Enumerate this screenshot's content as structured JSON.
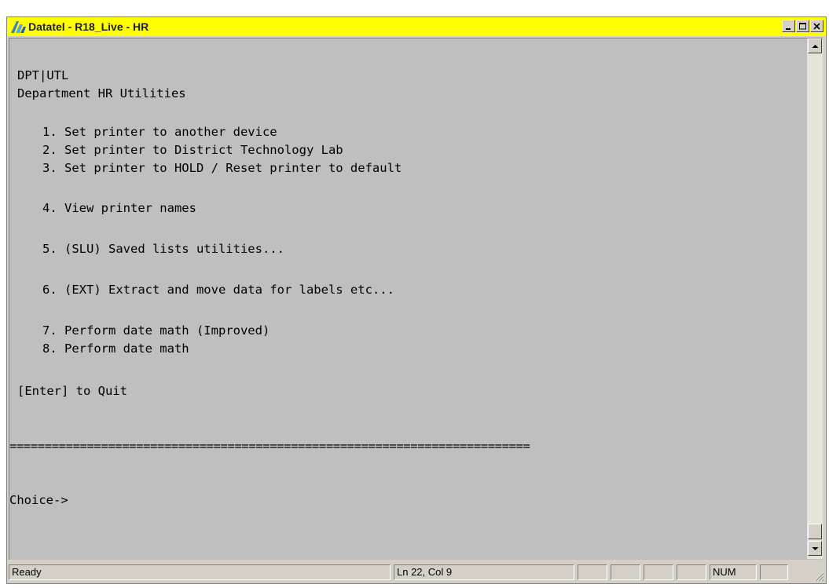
{
  "window": {
    "title": "Datatel - R18_Live - HR",
    "minimize_glyph": "_",
    "maximize_glyph": "□",
    "close_glyph": "×"
  },
  "terminal": {
    "header_code": "DPT|UTL",
    "header_title": "Department HR Utilities",
    "menu_items": [
      "1. Set printer to another device",
      "2. Set printer to District Technology Lab",
      "3. Set printer to HOLD / Reset printer to default",
      "4. View printer names",
      "5. (SLU) Saved lists utilities...",
      "6. (EXT) Extract and move data for labels etc...",
      "7. Perform date math (Improved)",
      "8. Perform date math"
    ],
    "quit_hint": "[Enter] to Quit",
    "separator": "==========================================================================",
    "prompt": "Choice->"
  },
  "statusbar": {
    "status": "Ready",
    "position": "Ln 22, Col 9",
    "num": "NUM"
  },
  "colors": {
    "titlebar": "#ffff00",
    "terminal_bg": "#bfbfbf",
    "chrome": "#d4d0c8"
  },
  "icons": {
    "app": "datatel-logo-icon",
    "scroll_up": "arrow-up-icon",
    "scroll_down": "arrow-down-icon",
    "resize": "size-grip-icon"
  }
}
